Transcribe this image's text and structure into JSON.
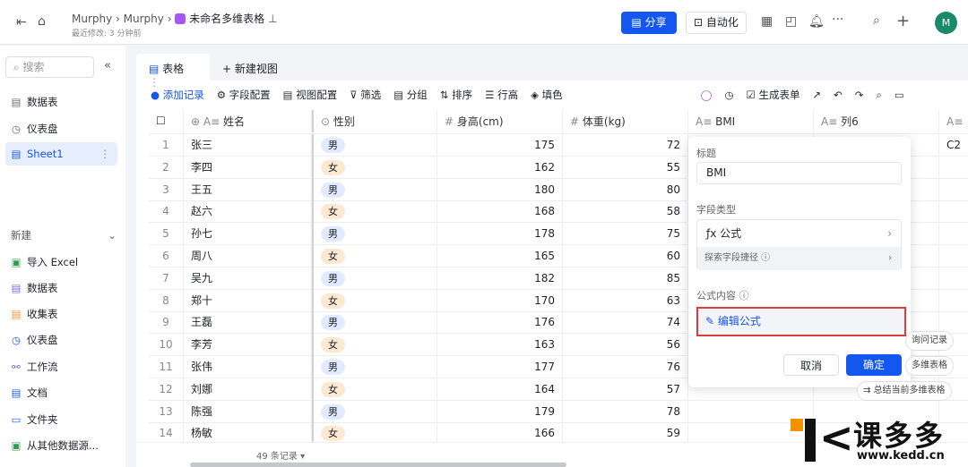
{
  "header": {
    "breadcrumb": [
      "Murphy",
      "Murphy"
    ],
    "doc_title": "未命名多维表格",
    "last_modified": "最近修改: 3 分钟前",
    "share": "分享",
    "automation": "自动化",
    "avatar": "M"
  },
  "sidebar": {
    "search_placeholder": "搜索",
    "items": [
      "数据表",
      "仪表盘",
      "Sheet1"
    ],
    "new_label": "新建",
    "new_items": [
      "导入 Excel",
      "数据表",
      "收集表",
      "仪表盘",
      "工作流",
      "文档",
      "文件夹",
      "从其他数据源..."
    ]
  },
  "tabs": {
    "active": "表格",
    "new_view": "新建视图"
  },
  "toolbar": {
    "add": "添加记录",
    "items": [
      "字段配置",
      "视图配置",
      "筛选",
      "分组",
      "排序",
      "行高",
      "填色"
    ],
    "form": "生成表单"
  },
  "table": {
    "headers": [
      "姓名",
      "性别",
      "身高(cm)",
      "体重(kg)",
      "BMI",
      "列6"
    ],
    "rows": [
      [
        "1",
        "张三",
        "男",
        "175",
        "72"
      ],
      [
        "2",
        "李四",
        "女",
        "162",
        "55"
      ],
      [
        "3",
        "王五",
        "男",
        "180",
        "80"
      ],
      [
        "4",
        "赵六",
        "女",
        "168",
        "58"
      ],
      [
        "5",
        "孙七",
        "男",
        "178",
        "75"
      ],
      [
        "6",
        "周八",
        "女",
        "165",
        "60"
      ],
      [
        "7",
        "吴九",
        "男",
        "182",
        "85"
      ],
      [
        "8",
        "郑十",
        "女",
        "170",
        "63"
      ],
      [
        "9",
        "王磊",
        "男",
        "176",
        "74"
      ],
      [
        "10",
        "李芳",
        "女",
        "163",
        "56"
      ],
      [
        "11",
        "张伟",
        "男",
        "177",
        "76"
      ],
      [
        "12",
        "刘娜",
        "女",
        "164",
        "57"
      ],
      [
        "13",
        "陈强",
        "男",
        "179",
        "78"
      ],
      [
        "14",
        "杨敏",
        "女",
        "166",
        "59"
      ]
    ],
    "col7_first": "C2",
    "record_count": "49 条记录"
  },
  "popover": {
    "title_label": "标题",
    "title_value": "BMI",
    "type_label": "字段类型",
    "type_value": "公式",
    "shortcut": "探索字段捷径",
    "formula_label": "公式内容",
    "edit_formula": "编辑公式",
    "cancel": "取消",
    "confirm": "确定"
  },
  "chips": [
    "询问记录",
    "多维表格",
    "总结当前多维表格"
  ],
  "watermark": {
    "brand": "课多多",
    "url": "www.kedd.cn"
  }
}
